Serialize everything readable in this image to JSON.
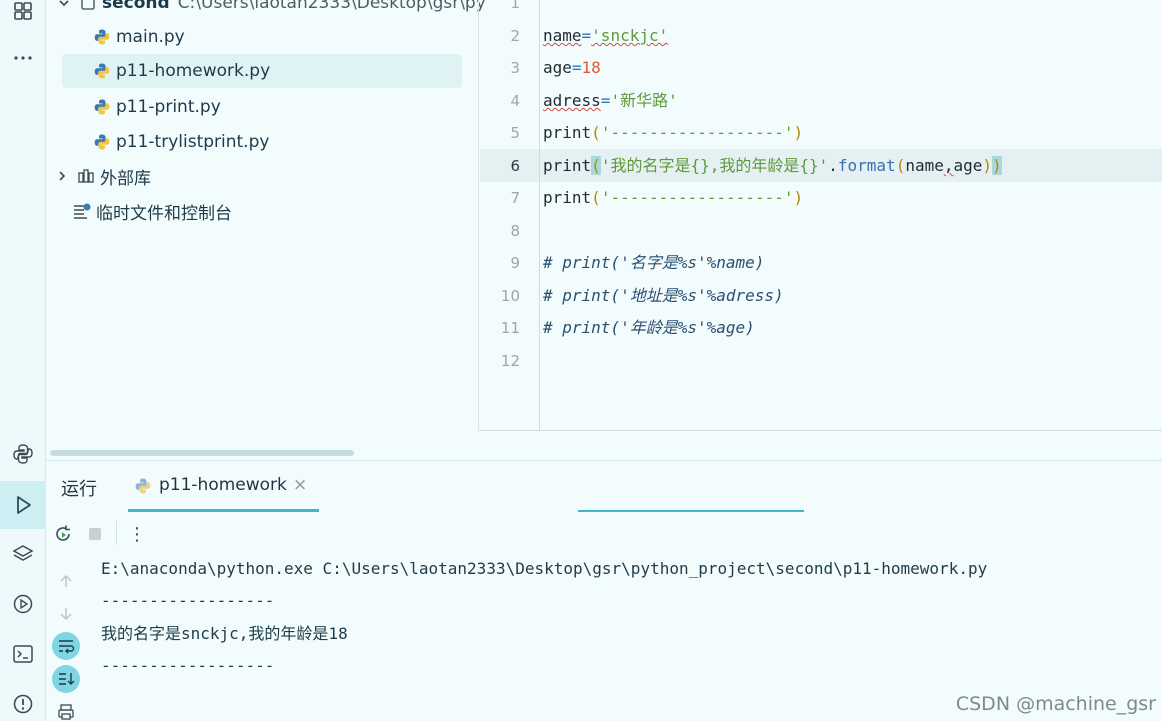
{
  "tree": {
    "root_name": "second",
    "root_path": "C:\\Users\\laotan2333\\Desktop\\gsr\\py",
    "files": [
      {
        "name": "main.py"
      },
      {
        "name": "p11-homework.py"
      },
      {
        "name": "p11-print.py"
      },
      {
        "name": "p11-trylistprint.py"
      }
    ],
    "external_libs": "外部库",
    "scratch": "临时文件和控制台"
  },
  "editor": {
    "line_numbers": [
      "1",
      "2",
      "3",
      "4",
      "5",
      "6",
      "7",
      "8",
      "9",
      "10",
      "11",
      "12"
    ],
    "current_line": "6",
    "lines": {
      "l2": {
        "var": "name",
        "eq": "=",
        "str": "'snckjc'"
      },
      "l3": {
        "var": "age",
        "eq": "=",
        "num": "18"
      },
      "l4": {
        "var": "adress",
        "eq": "=",
        "str": "'新华路'"
      },
      "l5": {
        "fn": "print",
        "open": "(",
        "str": "'------------------'",
        "close": ")"
      },
      "l6": {
        "fn": "print",
        "open": "(",
        "str": "'我的名字是{},我的年龄是{}'",
        "dot": ".",
        "method": "format",
        "args_open": "(",
        "a1": "name",
        "comma": ",",
        "a2": "age",
        "args_close": ")",
        "close": ")"
      },
      "l7": {
        "fn": "print",
        "open": "(",
        "str": "'------------------'",
        "close": ")"
      },
      "l9": "# print('名字是%s'%name)",
      "l10": "# print('地址是%s'%adress)",
      "l11": "# print('年龄是%s'%age)"
    }
  },
  "run": {
    "tab_run": "运行",
    "tab_file": "p11-homework",
    "close_glyph": "×",
    "more_glyph": "⋮",
    "console": [
      "E:\\anaconda\\python.exe C:\\Users\\laotan2333\\Desktop\\gsr\\python_project\\second\\p11-homework.py",
      "------------------",
      "我的名字是snckjc,我的年龄是18",
      "------------------"
    ]
  },
  "watermark": "CSDN @machine_gsr",
  "colors": {
    "accent": "#3fb7c9",
    "background": "#f2fcfd",
    "string": "#5f9a3a",
    "number": "#e05a2b"
  }
}
